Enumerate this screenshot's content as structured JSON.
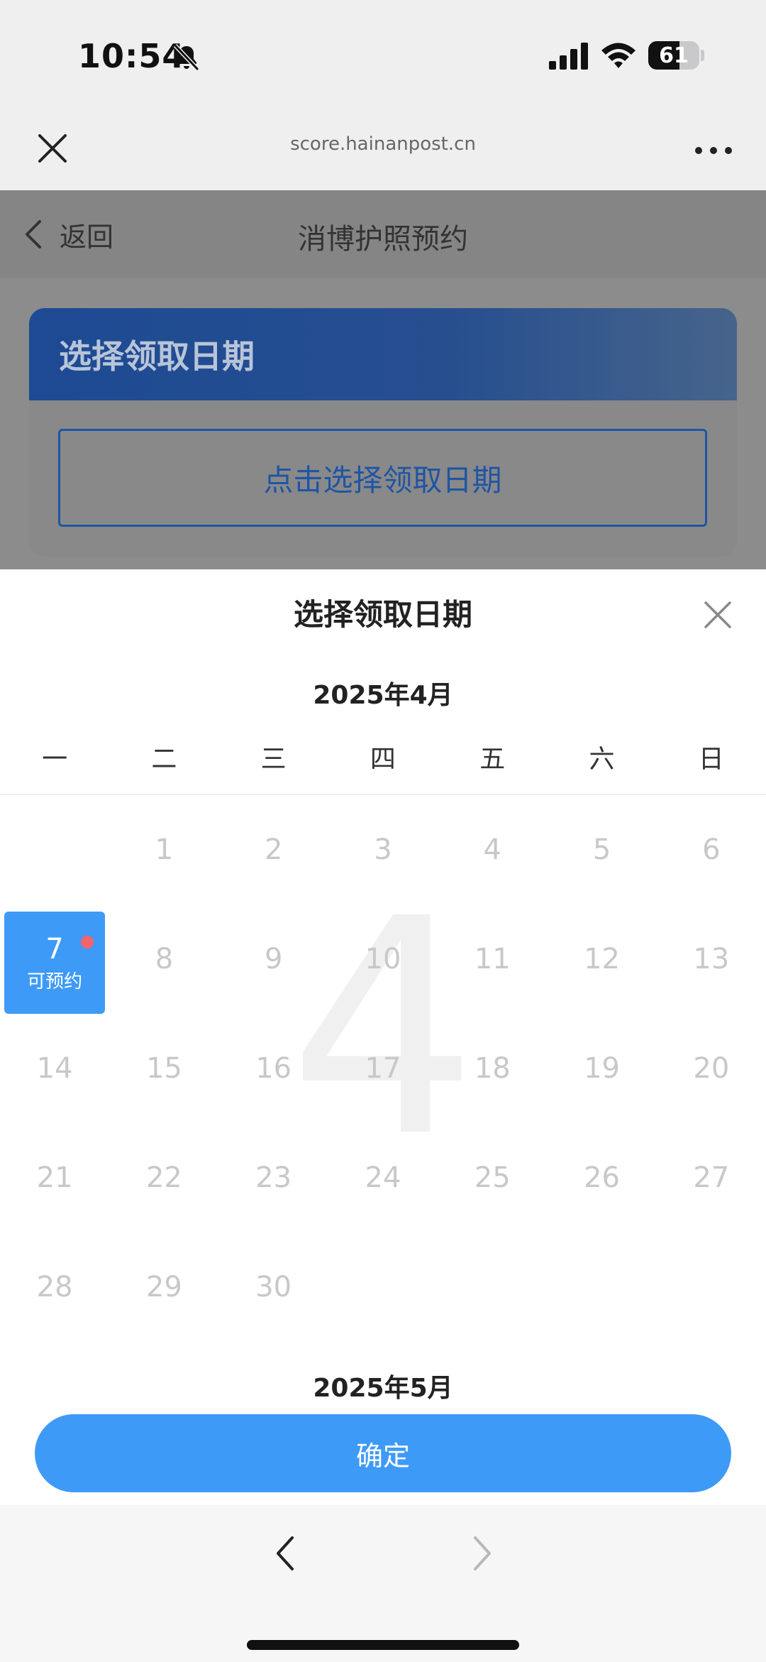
{
  "status_bar": {
    "time": "10:54",
    "battery": "61",
    "battery_level": 0.61
  },
  "browser": {
    "url": "score.hainanpost.cn"
  },
  "nav": {
    "back_label": "返回",
    "title": "消博护照预约"
  },
  "card": {
    "header": "选择领取日期",
    "pick_button": "点击选择领取日期"
  },
  "sheet": {
    "title": "选择领取日期",
    "weekdays": [
      "一",
      "二",
      "三",
      "四",
      "五",
      "六",
      "日"
    ],
    "months": [
      {
        "title": "2025年4月",
        "watermark": "4",
        "first_weekday_index": 1,
        "days": [
          "1",
          "2",
          "3",
          "4",
          "5",
          "6",
          "7",
          "8",
          "9",
          "10",
          "11",
          "12",
          "13",
          "14",
          "15",
          "16",
          "17",
          "18",
          "19",
          "20",
          "21",
          "22",
          "23",
          "24",
          "25",
          "26",
          "27",
          "28",
          "29",
          "30"
        ],
        "available": {
          "day": "7",
          "label": "可预约"
        }
      },
      {
        "title": "2025年5月"
      }
    ],
    "confirm_label": "确定"
  },
  "colors": {
    "accent": "#3e9af7",
    "dot": "#f5636b",
    "header_blue": "#1d4a94"
  }
}
